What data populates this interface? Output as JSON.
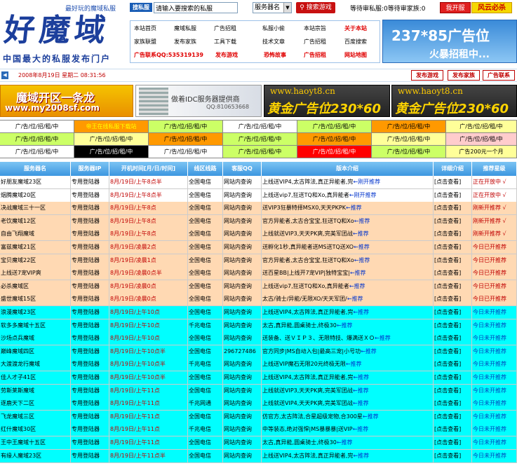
{
  "header": {
    "slogan": "最好玩的魔域私服",
    "logo_text": "好魔域",
    "logo_sub": "中国最大的私服发布门户",
    "search_label": "搜私服",
    "search_placeholder": "请输入要搜索的私服",
    "search_select": "服务器名",
    "search_button": "搜索游戏",
    "queue_text": "等待审私服:0等待审家族:0",
    "btn_open": "我开服",
    "btn_fyb": "风云必杀"
  },
  "nav": {
    "row1": [
      "本站首页",
      "魔域私服",
      "广告招租",
      "私服小偷",
      "本站宗旨",
      "关于本站"
    ],
    "row2": [
      "家族联盟",
      "发布家族",
      "工具下载",
      "技术文章",
      "广告招租",
      "百度搜索"
    ],
    "row3": [
      "广告联系QQ:535319139",
      "发布游戏",
      "恐怖故事",
      "广告招租",
      "网站地图"
    ]
  },
  "ad_right": {
    "line1": "237*85广告位",
    "line2": "火暴招租中..."
  },
  "datebar": {
    "date": "2008年8月19日 星期二 08:31:56",
    "btn_publish_game": "发布游戏",
    "btn_publish_family": "发布家族",
    "btn_ad_contact": "广告联系"
  },
  "banners": {
    "b1_line1": "魔域开区一条龙",
    "b1_line2": "www.my2008sf.com",
    "b2_line1": "做着IDC服务器提供商",
    "b2_line2": "QQ:810653668",
    "b3_line1": "www.haoyt8.cn",
    "b3_line2": "黄金广告位230*60",
    "b4_line1": "www.haoyt8.cn",
    "b4_line2": "黄金广告位230*60"
  },
  "ad_grid": {
    "rows": [
      [
        {
          "t": "广/告/位/招/租/中",
          "bg": "#ffffff",
          "fg": "#000000"
        },
        {
          "t": "帝王在线私服下载站",
          "bg": "#ff9900",
          "fg": "#ffff00"
        },
        {
          "t": "广/告/位/招/租/中",
          "bg": "#ccff66",
          "fg": "#000000"
        },
        {
          "t": "广/告/位/招/租/中",
          "bg": "#ffffff",
          "fg": "#000000"
        },
        {
          "t": "广/告/位/招/租/中",
          "bg": "#ccff66",
          "fg": "#000000"
        },
        {
          "t": "广/告/位/招/租/中",
          "bg": "#ff9900",
          "fg": "#000000"
        },
        {
          "t": "广/告/位/招/租/中",
          "bg": "#ffff99",
          "fg": "#000000"
        }
      ],
      [
        {
          "t": "广/告/位/招/租/中",
          "bg": "#ccff66",
          "fg": "#000000"
        },
        {
          "t": "广/告/位/招/租/中",
          "bg": "#ffff99",
          "fg": "#000000"
        },
        {
          "t": "广/告/位/招/租/中",
          "bg": "#ff9900",
          "fg": "#000000"
        },
        {
          "t": "广/告/位/招/租/中",
          "bg": "#ccff66",
          "fg": "#000000"
        },
        {
          "t": "广/告/位/招/租/中",
          "bg": "#ff9900",
          "fg": "#000000"
        },
        {
          "t": "广/告/位/招/租/中",
          "bg": "#ffff99",
          "fg": "#000000"
        },
        {
          "t": "广/告/位/招/租/中",
          "bg": "#ffcccc",
          "fg": "#000000"
        }
      ],
      [
        {
          "t": "广/告/位/招/租/中",
          "bg": "#ffffff",
          "fg": "#000000"
        },
        {
          "t": "广/告/位/招/租/中",
          "bg": "#000000",
          "fg": "#ffffff"
        },
        {
          "t": "广/告/位/招/租/中",
          "bg": "#ffffff",
          "fg": "#000000"
        },
        {
          "t": "广/告/位/招/租/中",
          "bg": "#ccff66",
          "fg": "#000000"
        },
        {
          "t": "广/告/位/招/租/中",
          "bg": "#ff0000",
          "fg": "#ffffff"
        },
        {
          "t": "广/告/位/招/租/中",
          "bg": "#ccff66",
          "fg": "#000000"
        },
        {
          "t": "广告200元一个月",
          "bg": "#ffff99",
          "fg": "#000000"
        }
      ]
    ]
  },
  "table": {
    "headers": [
      "服务器名",
      "服务器IP",
      "开机时间[月/日/时间]",
      "线区线路",
      "客服QQ",
      "版本介绍",
      "详细介绍",
      "推荐星级"
    ],
    "rows": [
      {
        "bg": "#ffffff",
        "name": "好朋友魔域23区",
        "ip": "专用登陆器",
        "time": "8月/19日/上午8点半",
        "line": "全国电信",
        "qq": "网站内查询",
        "intro": "上线送VIP4,太古阵法,真正异能者,完",
        "arrow": "←刚开推荐",
        "detail": "[点击查看]",
        "rec": "正在开放中 √"
      },
      {
        "bg": "#ffffff",
        "name": "烟腾魔域20区",
        "ip": "专用登陆器",
        "time": "8月/19日/上午8点半",
        "line": "全国电信",
        "qq": "网站内查询",
        "intro": "上线送vip7,狂送TQ和Xo,真异能者",
        "arrow": "←刚开推荐",
        "detail": "[点击查看]",
        "rec": "正在开放中 √"
      },
      {
        "bg": "#ffd9b3",
        "name": "决战魔域三十一区",
        "ip": "专用登陆器",
        "time": "8月/19日/上午8点",
        "line": "全国电信",
        "qq": "网站内查询",
        "intro": "送VIP3狂暴特择MSX0,天天PKPK",
        "arrow": "←推荐",
        "detail": "[点击查看]",
        "rec": "刚新开推荐 √"
      },
      {
        "bg": "#ffd9b3",
        "name": "老饮魔域12区",
        "ip": "专用登陆器",
        "time": "8月/19日/上午8点",
        "line": "全国电信",
        "qq": "网站内查询",
        "intro": "官方异能者,太古合宝宝,狂送TQ和Xo",
        "arrow": "←推荐",
        "detail": "[点击查看]",
        "rec": "刚新开推荐 √"
      },
      {
        "bg": "#ffd9b3",
        "name": "自由飞翔魔域",
        "ip": "专用登陆器",
        "time": "8月/19日/上午8点",
        "line": "全国电信",
        "qq": "网站内查询",
        "intro": "上线就送VIP3,天天PK爽,完美军团战",
        "arrow": "←推荐",
        "detail": "[点击查看]",
        "rec": "刚新开推荐 √"
      },
      {
        "bg": "#ffd9b3",
        "name": "富兹魔域21区",
        "ip": "专用登陆器",
        "time": "8月/19日/凌晨2点",
        "line": "全国电信",
        "qq": "网站内查询",
        "intro": "送孵化1秒,真异能者送MS送TQ送XO",
        "arrow": "←推荐",
        "detail": "[点击查看]",
        "rec": "今日已开推荐"
      },
      {
        "bg": "#ffd9b3",
        "name": "宝贝魔域22区",
        "ip": "专用登陆器",
        "time": "8月/19日/凌晨1点",
        "line": "全国电信",
        "qq": "网站内查询",
        "intro": "官方异能者,太古合宝宝,狂送TQ和Xo",
        "arrow": "←推荐",
        "detail": "[点击查看]",
        "rec": "今日已开推荐"
      },
      {
        "bg": "#ffd9b3",
        "name": "上线送7宠VIP爽",
        "ip": "专用登陆器",
        "time": "8月/19日/凌晨0点半",
        "line": "全国电信",
        "qq": "网站内查询",
        "intro": "送百星BB|上线开7宠VIP|独特宝宝|",
        "arrow": "←推荐",
        "detail": "[点击查看]",
        "rec": "今日已开推荐"
      },
      {
        "bg": "#ffd9b3",
        "name": "必杀魔域区",
        "ip": "专用登陆器",
        "time": "8月/19日/凌晨0点",
        "line": "全国电信",
        "qq": "网站内查询",
        "intro": "上线送vip7,狂送TQ和Xo,真异能者",
        "arrow": "←推荐",
        "detail": "[点击查看]",
        "rec": "今日已开推荐"
      },
      {
        "bg": "#ffd9b3",
        "name": "盛世魔域15区",
        "ip": "专用登陆器",
        "time": "8月/19日/凌晨0点",
        "line": "全国电信",
        "qq": "网站内查询",
        "intro": "太古/骑士/异能/无限XO/天天军团/",
        "arrow": "←推荐",
        "detail": "[点击查看]",
        "rec": "今日已开推荐"
      },
      {
        "bg": "#00ffff",
        "name": "浪漫魔域23区",
        "ip": "专用登陆器",
        "time": "8月/19日/上午10点",
        "line": "全国电信",
        "qq": "网站内查询",
        "intro": "上线送VIP4,太古阵法,真正异能者,完",
        "arrow": "←推荐",
        "detail": "[点击查看]",
        "rec": "今日未开推荐"
      },
      {
        "bg": "#00ffff",
        "name": "软多多魔域十五区",
        "ip": "专用登陆器",
        "time": "8月/19日/上午10点",
        "line": "千兆电信",
        "qq": "网站内查询",
        "intro": "太古,真异能,圆桌骑士,终极30",
        "arrow": "←推荐",
        "detail": "[点击查看]",
        "rec": "今日未开推荐"
      },
      {
        "bg": "#00ffff",
        "name": "沙场点兵魔域",
        "ip": "专用登陆器",
        "time": "8月/19日/上午10点",
        "line": "全国电信",
        "qq": "网站内查询",
        "intro": "送装备、送ＶＩＰ３、无限特技、爆满送ＸＯ",
        "arrow": "←推荐",
        "detail": "[点击查看]",
        "rec": "今日未开推荐"
      },
      {
        "bg": "#00ffff",
        "name": "巅峰魔域四区",
        "ip": "专用登陆器",
        "time": "8月/19日/上午10点半",
        "line": "全国电信",
        "qq": "296727486",
        "intro": "官方同步|MS自动入包|最高三宠|小号功",
        "arrow": "←推荐",
        "detail": "[点击查看]",
        "rec": "今日未开推荐"
      },
      {
        "bg": "#00ffff",
        "name": "大渡渡龙行魔域",
        "ip": "专用登陆器",
        "time": "8月/19日/上午10点半",
        "line": "千兆电信",
        "qq": "网站内查询",
        "intro": "上线送VIP魔石无限20元终极无限",
        "arrow": "←推荐",
        "detail": "[点击查看]",
        "rec": "今日未开推荐"
      },
      {
        "bg": "#00ffff",
        "name": "佳人才子41区",
        "ip": "专用登陆器",
        "time": "8月/19日/上午10点半",
        "line": "全国电信",
        "qq": "网站内查询",
        "intro": "上线送VIP4,太古阵法,真正异能者,完",
        "arrow": "←推荐",
        "detail": "[点击查看]",
        "rec": "今日未开推荐"
      },
      {
        "bg": "#00ffff",
        "name": "劳斯莱斯魔域",
        "ip": "专用登陆器",
        "time": "8月/19日/上午11点",
        "line": "全国电信",
        "qq": "网站内查询",
        "intro": "上线就送VIP3,天天PK爽,完美军团战",
        "arrow": "←推荐",
        "detail": "[点击查看]",
        "rec": "今日未开推荐"
      },
      {
        "bg": "#00ffff",
        "name": "逐鹿天下二区",
        "ip": "专用登陆器",
        "time": "8月/19日/上午11点",
        "line": "千兆网通",
        "qq": "网站内查询",
        "intro": "上线就送VIP4,天天PK爽,完美军团战",
        "arrow": "←推荐",
        "detail": "[点击查看]",
        "rec": "今日未开推荐"
      },
      {
        "bg": "#00ffff",
        "name": "飞龙魔域三区",
        "ip": "专用登陆器",
        "time": "8月/19日/上午11点",
        "line": "全国电信",
        "qq": "网站内查询",
        "intro": "仿官方,太古阵法,合星超级宠物,合300星",
        "arrow": "←推荐",
        "detail": "[点击查看]",
        "rec": "今日未开推荐"
      },
      {
        "bg": "#00ffff",
        "name": "红什魔域30区",
        "ip": "专用登陆器",
        "time": "8月/19日/上午11点",
        "line": "千兆电信",
        "qq": "网站内查询",
        "intro": "中等装态,绝对强悍|MS暴暴暴|送VIP",
        "arrow": "←推荐",
        "detail": "[点击查看]",
        "rec": "今日未开推荐"
      },
      {
        "bg": "#00ffff",
        "name": "王中王魔域十五区",
        "ip": "专用登陆器",
        "time": "8月/19日/上午11点",
        "line": "全国电信",
        "qq": "网站内查询",
        "intro": "太古,真异能,圆桌骑士,终极30",
        "arrow": "←推荐",
        "detail": "[点击查看]",
        "rec": "今日未开推荐"
      },
      {
        "bg": "#00ffff",
        "name": "有缘人魔域23区",
        "ip": "专用登陆器",
        "time": "8月/19日/上午11点半",
        "line": "全国电信",
        "qq": "网站内查询",
        "intro": "上线送VIP4,太古阵法,真正异能者,完",
        "arrow": "←推荐",
        "detail": "[点击查看]",
        "rec": "今日未开推荐"
      }
    ]
  }
}
